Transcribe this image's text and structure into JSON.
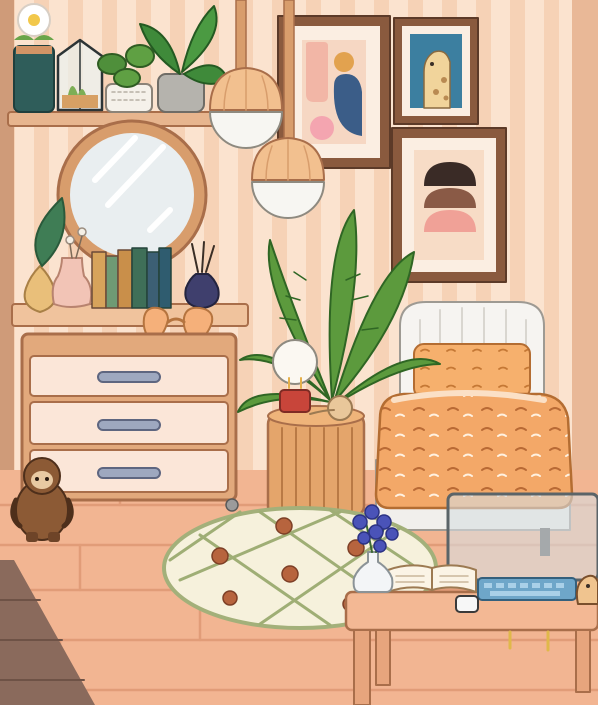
{
  "scene": {
    "title": "",
    "style": "cozy bedroom illustration",
    "palette": {
      "wall_stripe_light": "#fbe3cf",
      "wall_stripe_dark": "#f6d2b6",
      "wood": "#d99d72",
      "wood_dark": "#a96e4a",
      "floor": "#f2b592",
      "floor_line": "#e19c78",
      "plant_green": "#5c9a3d",
      "bed_orange": "#f3a868",
      "outline": "#6b4a38"
    }
  },
  "objects": {
    "wall_shelf": {
      "items": [
        "daisy-pot",
        "terrarium",
        "leafy-plant",
        "monstera-plant"
      ]
    },
    "mirror": {},
    "vanity_shelf": {
      "items": [
        "feather-vase",
        "cotton-vase",
        "pink-vase",
        "book-row",
        "reed-diffuser",
        "heart-sunglasses"
      ]
    },
    "books": {
      "colors": [
        "#d7a35b",
        "#6f9a74",
        "#c98f4a",
        "#3f6f58",
        "#3c5f74",
        "#2f5c6f"
      ]
    },
    "dresser": {
      "drawers": 3
    },
    "pendant_lamps": {
      "count": 2
    },
    "wall_art": [
      {
        "name": "abstract-shapes-print"
      },
      {
        "name": "giraffe-print"
      },
      {
        "name": "arches-print"
      }
    ],
    "potted_palm": {},
    "side_table": {
      "items": [
        "bulb-lamp",
        "dried-flower"
      ]
    },
    "bed": {},
    "rug": {
      "shape": "round"
    },
    "desk": {
      "items": [
        "flower-vase",
        "open-book",
        "computer-monitor",
        "keyboard",
        "mug",
        "figurine"
      ]
    },
    "sloth_plush": {}
  }
}
